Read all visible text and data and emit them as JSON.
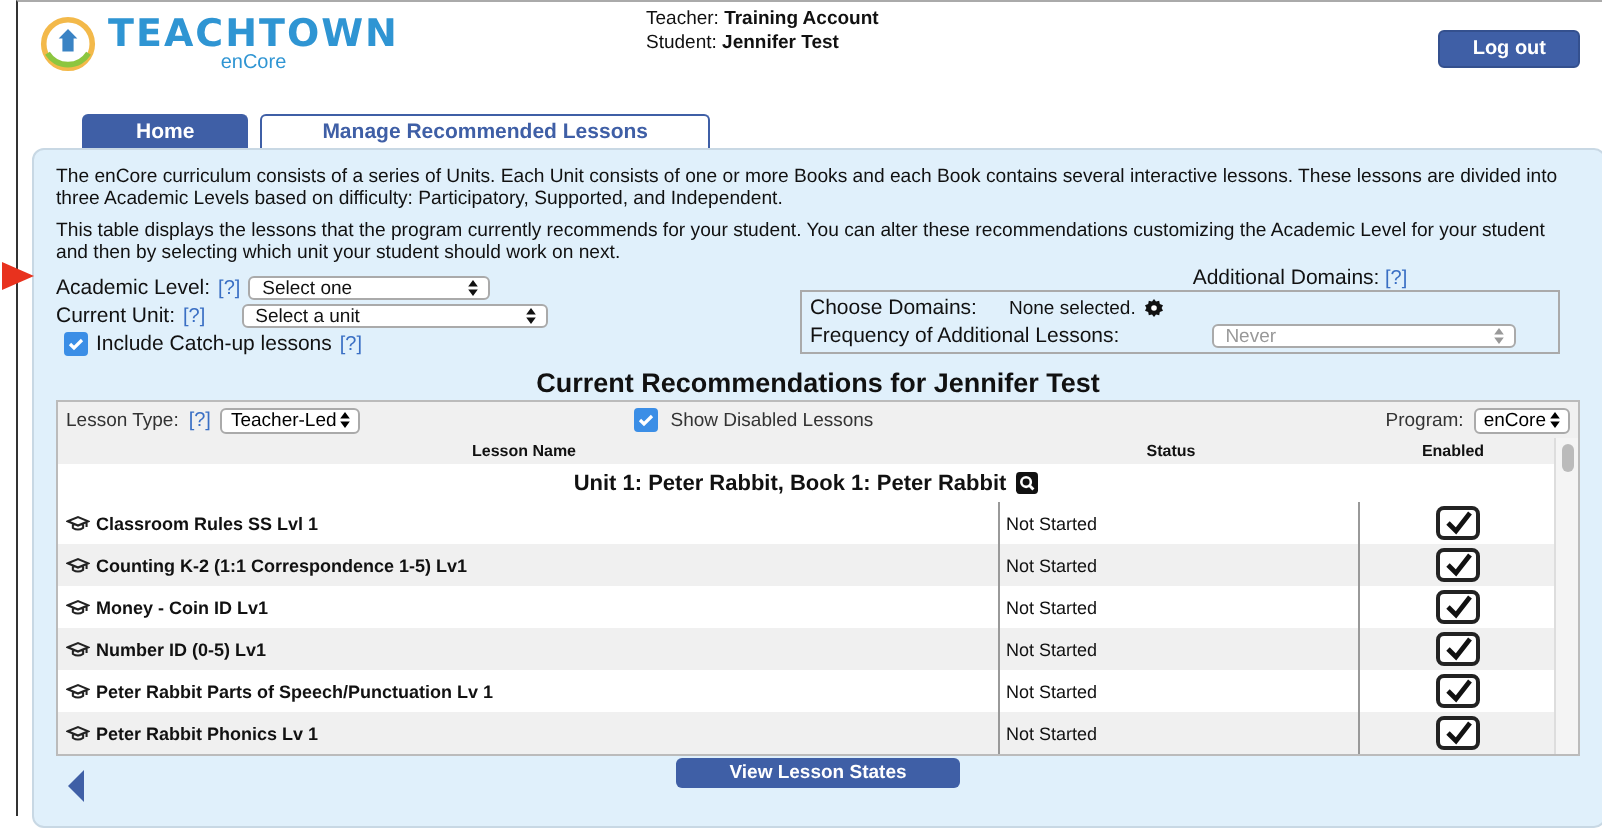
{
  "header": {
    "logo_title": "TEACHTOWN",
    "logo_subtitle": "enCore",
    "teacher_label": "Teacher:",
    "teacher": "Training Account",
    "student_label": "Student:",
    "student": "Jennifer Test",
    "logout": "Log out"
  },
  "tabs": [
    {
      "label": "Home",
      "selected": true
    },
    {
      "label": "Manage Recommended Lessons",
      "selected": false
    }
  ],
  "intro": [
    "The enCore curriculum consists of a series of Units. Each Unit consists of one or more Books and each Book contains several interactive lessons. These lessons are divided into three Academic Levels based on difficulty: Participatory, Supported, and Independent.",
    "This table displays the lessons that the program currently recommends for your student. You can alter these recommendations customizing the Academic Level for your student and then by selecting which unit your student should work on next."
  ],
  "settings": {
    "academic_level": {
      "label": "Academic Level:",
      "help": "[?]",
      "value": "Select one"
    },
    "current_unit": {
      "label": "Current Unit:",
      "help": "[?]",
      "value": "Select a unit"
    },
    "catch_up": {
      "label": "Include Catch-up lessons",
      "help": "[?]",
      "checked": true
    }
  },
  "additional_domains": {
    "title": "Additional Domains:",
    "help": "[?]",
    "choose_label": "Choose Domains:",
    "choose_value": "None selected.",
    "frequency_label": "Frequency of Additional Lessons:",
    "frequency_value": "Never",
    "frequency_disabled": true
  },
  "recommendations": {
    "title": "Current Recommendations for Jennifer Test",
    "lesson_type_label": "Lesson Type:",
    "lesson_type_help": "[?]",
    "lesson_type": "Teacher-Led",
    "show_disabled_label": "Show Disabled Lessons",
    "show_disabled": true,
    "program_label": "Program:",
    "program": "enCore",
    "columns": [
      "Lesson Name",
      "Status",
      "Enabled"
    ],
    "group": "Unit 1: Peter Rabbit, Book 1: Peter Rabbit",
    "rows": [
      {
        "name": "Classroom Rules SS Lvl 1",
        "status": "Not Started",
        "enabled": true
      },
      {
        "name": "Counting K-2 (1:1 Correspondence 1-5) Lv1",
        "status": "Not Started",
        "enabled": true
      },
      {
        "name": "Money - Coin ID Lv1",
        "status": "Not Started",
        "enabled": true
      },
      {
        "name": "Number ID (0-5) Lv1",
        "status": "Not Started",
        "enabled": true
      },
      {
        "name": "Peter Rabbit Parts of Speech/Punctuation Lv 1",
        "status": "Not Started",
        "enabled": true
      },
      {
        "name": "Peter Rabbit Phonics Lv 1",
        "status": "Not Started",
        "enabled": true
      }
    ],
    "view_states": "View Lesson States"
  }
}
